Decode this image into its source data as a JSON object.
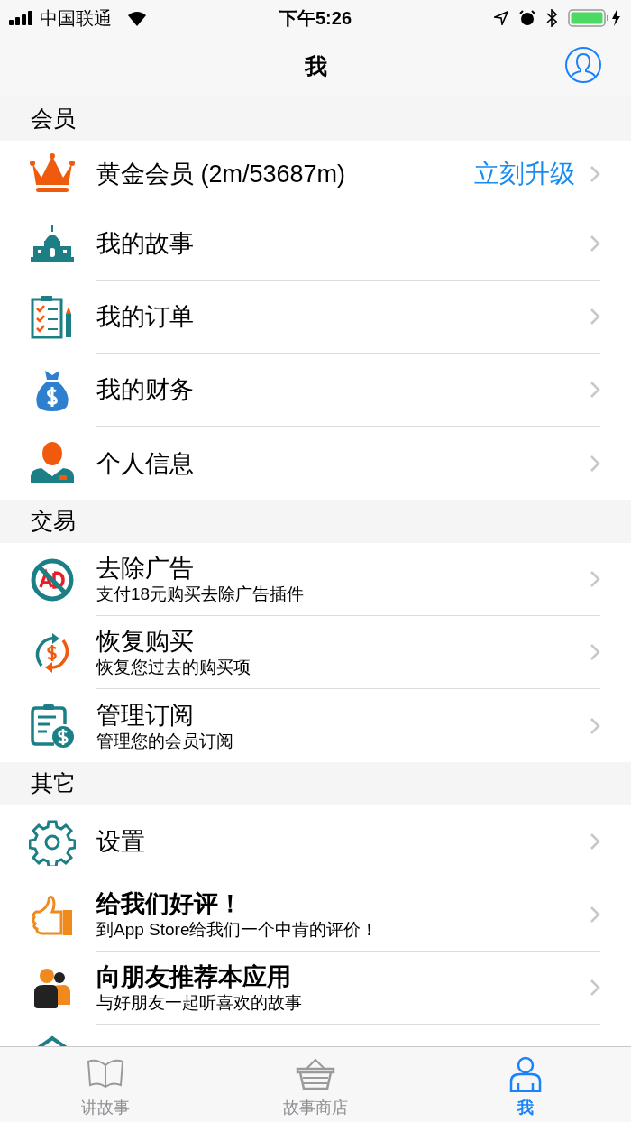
{
  "status_bar": {
    "carrier": "中国联通",
    "time": "下午5:26"
  },
  "nav": {
    "title": "我"
  },
  "sections": [
    {
      "header": "会员",
      "items": [
        {
          "kind": "crown",
          "title": "黄金会员 (2m/53687m)",
          "bold": false,
          "action": "立刻升级"
        },
        {
          "kind": "building",
          "title": "我的故事",
          "bold": false
        },
        {
          "kind": "clipboard",
          "title": "我的订单",
          "bold": false
        },
        {
          "kind": "moneybag",
          "title": "我的财务",
          "bold": false
        },
        {
          "kind": "person",
          "title": "个人信息",
          "bold": false
        }
      ]
    },
    {
      "header": "交易",
      "items": [
        {
          "kind": "noad",
          "title": "去除广告",
          "subtitle": "支付18元购买去除广告插件",
          "bold": false
        },
        {
          "kind": "restore",
          "title": "恢复购买",
          "subtitle": "恢复您过去的购买项",
          "bold": false
        },
        {
          "kind": "subscription",
          "title": "管理订阅",
          "subtitle": "管理您的会员订阅",
          "bold": false
        }
      ]
    },
    {
      "header": "其它",
      "items": [
        {
          "kind": "gear",
          "title": "设置",
          "bold": false
        },
        {
          "kind": "thumb",
          "title": "给我们好评！",
          "subtitle": "到App Store给我们一个中肯的评价！",
          "bold": true
        },
        {
          "kind": "friends",
          "title": "向朋友推荐本应用",
          "subtitle": "与好朋友一起听喜欢的故事",
          "bold": true
        },
        {
          "kind": "house"
        }
      ]
    }
  ],
  "tabs": [
    {
      "kind": "book",
      "label": "讲故事",
      "selected": false
    },
    {
      "kind": "basket",
      "label": "故事商店",
      "selected": false
    },
    {
      "kind": "me",
      "label": "我",
      "selected": true
    }
  ]
}
